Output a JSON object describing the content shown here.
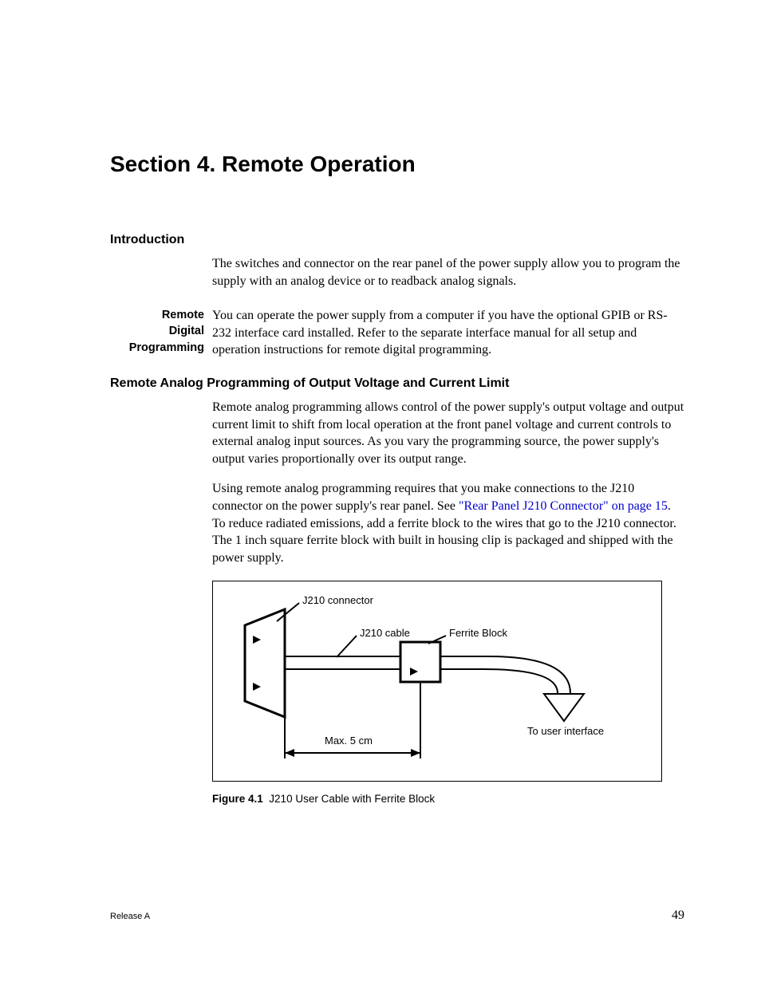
{
  "title": "Section 4. Remote Operation",
  "intro": {
    "heading": "Introduction",
    "text": "The switches and connector on the rear panel of the power supply allow you to program the supply with an analog device or to readback analog signals."
  },
  "remote_digital": {
    "label_l1": "Remote",
    "label_l2": "Digital",
    "label_l3": "Programming",
    "text": "You can operate the power supply from a computer if you have the optional GPIB or RS-232 interface card installed. Refer to the separate interface manual for all setup and operation instructions for remote digital programming."
  },
  "remote_analog": {
    "heading": "Remote Analog Programming of Output Voltage and Current Limit",
    "p1": "Remote analog programming allows control of the power supply's output voltage and output current limit to shift from local operation at the front panel voltage and current controls to external analog input sources. As you vary the programming source, the power supply's output varies proportionally over its output range.",
    "p2a": "Using remote analog programming requires that you make connections to the J210 connector on the power supply's rear panel. See ",
    "p2_link": "\"Rear Panel J210 Connector\" on page 15",
    "p2b": ". To reduce radiated emissions, add a ferrite block to the wires that go to the J210 connector. The 1 inch square ferrite block with built in housing clip is packaged and shipped with the power supply."
  },
  "figure": {
    "label_connector": "J210 connector",
    "label_cable": "J210 cable",
    "label_ferrite": "Ferrite Block",
    "label_user": "To user interface",
    "label_max": "Max. 5 cm",
    "caption_no": "Figure 4.1",
    "caption_text": "J210 User Cable with Ferrite Block"
  },
  "footer": {
    "release": "Release A",
    "page": "49"
  }
}
